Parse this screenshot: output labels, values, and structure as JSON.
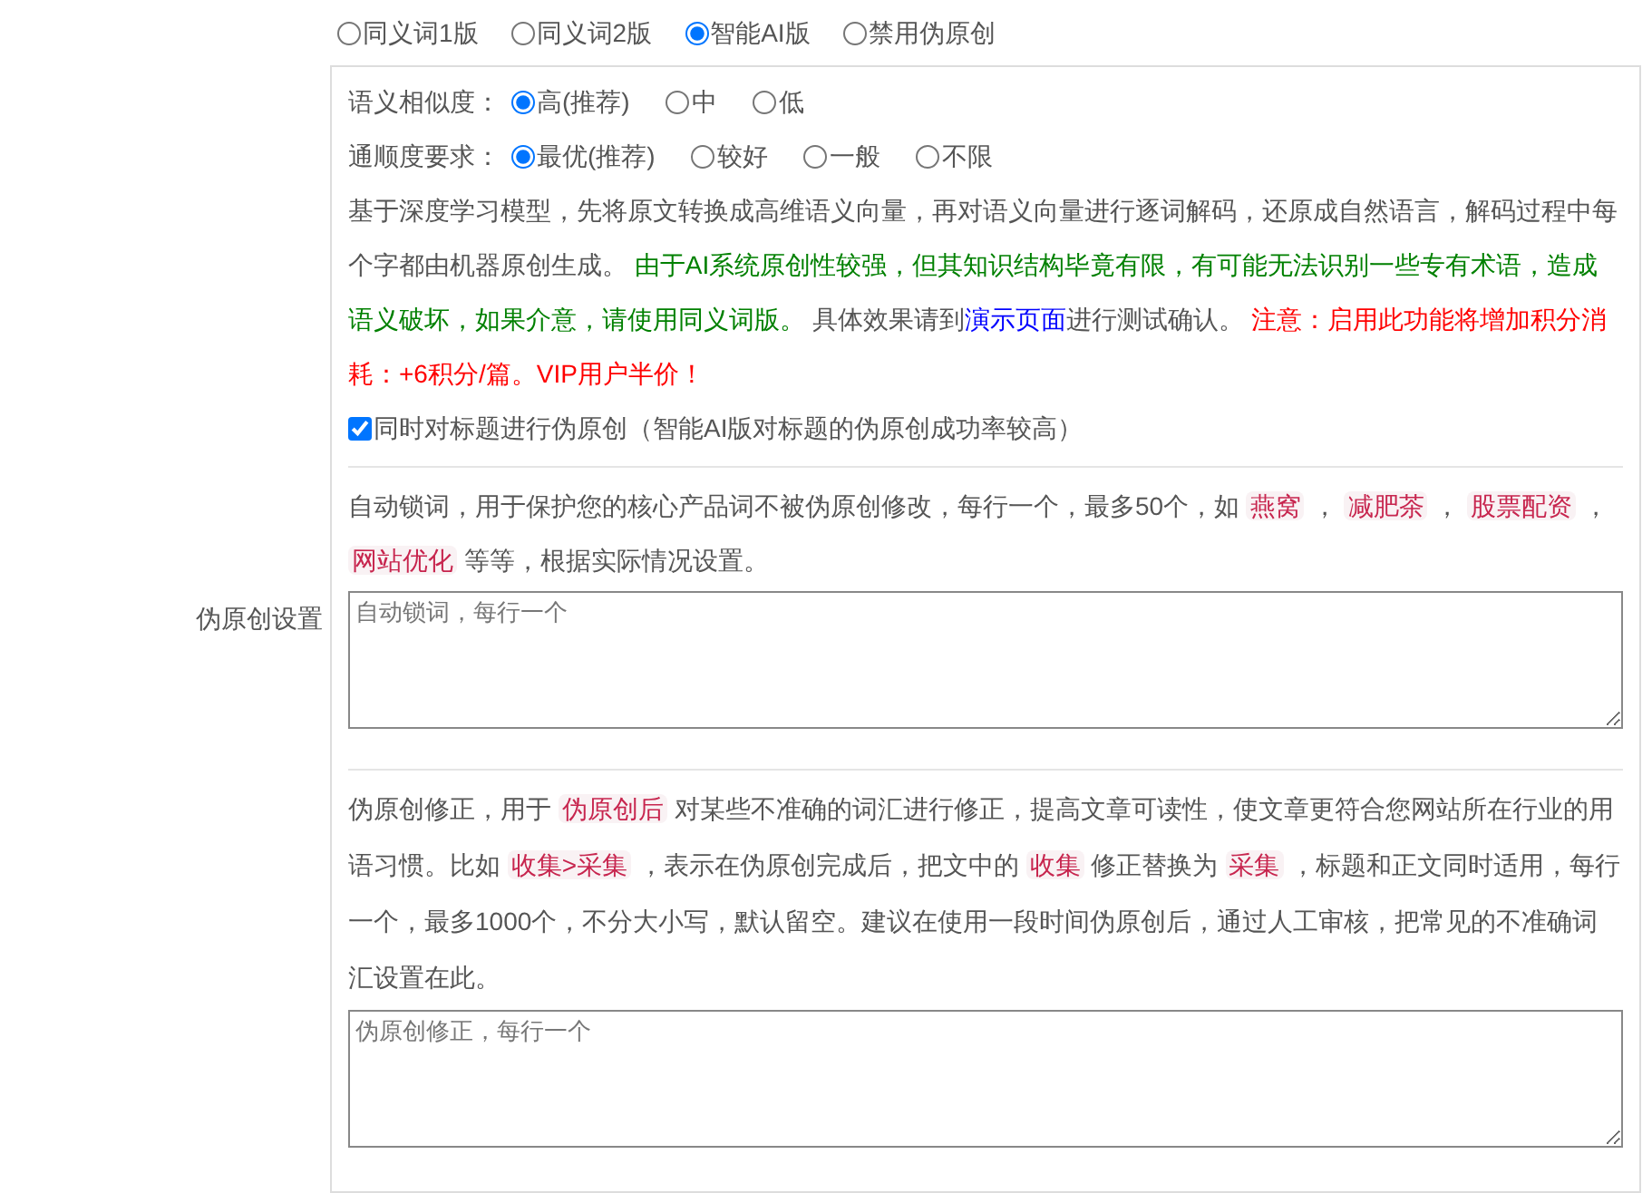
{
  "section_label": "伪原创设置",
  "modes": [
    {
      "label": "同义词1版",
      "selected": false
    },
    {
      "label": "同义词2版",
      "selected": false
    },
    {
      "label": "智能AI版",
      "selected": true
    },
    {
      "label": "禁用伪原创",
      "selected": false
    }
  ],
  "settings": [
    {
      "label": "语义相似度：",
      "options": [
        {
          "label": "高(推荐)",
          "selected": true
        },
        {
          "label": "中",
          "selected": false
        },
        {
          "label": "低",
          "selected": false
        }
      ]
    },
    {
      "label": "通顺度要求：",
      "options": [
        {
          "label": "最优(推荐)",
          "selected": true
        },
        {
          "label": "较好",
          "selected": false
        },
        {
          "label": "一般",
          "selected": false
        },
        {
          "label": "不限",
          "selected": false
        }
      ]
    }
  ],
  "description": [
    {
      "kind": "text",
      "text": "基于深度学习模型，先将原文转换成高维语义向量，再对语义向量进行逐词解码，还原成自然语言，解码过程中每个字都由机器原创生成。 "
    },
    {
      "kind": "notice",
      "text": "由于AI系统原创性较强，但其知识结构毕竟有限，有可能无法识别一些专有术语，造成语义破坏，如果介意，请使用同义词版。"
    },
    {
      "kind": "text",
      "text": " 具体效果请到"
    },
    {
      "kind": "link",
      "text": "演示页面"
    },
    {
      "kind": "text",
      "text": "进行测试确认。 "
    },
    {
      "kind": "warning",
      "text": "注意：启用此功能将增加积分消耗：+6积分/篇。VIP用户半价！"
    }
  ],
  "title_option": {
    "label": "同时对标题进行伪原创（智能AI版对标题的伪原创成功率较高）",
    "checked": true
  },
  "lock_words": {
    "description": [
      {
        "kind": "text",
        "text": "自动锁词，用于保护您的核心产品词不被伪原创修改，每行一个，最多50个，如 "
      },
      {
        "kind": "tag",
        "text": "燕窝"
      },
      {
        "kind": "text",
        "text": " ， "
      },
      {
        "kind": "tag",
        "text": "减肥茶"
      },
      {
        "kind": "text",
        "text": " ， "
      },
      {
        "kind": "tag",
        "text": "股票配资"
      },
      {
        "kind": "text",
        "text": " ， "
      },
      {
        "kind": "tag",
        "text": "网站优化"
      },
      {
        "kind": "text",
        "text": " 等等，根据实际情况设置。"
      }
    ],
    "placeholder": "自动锁词，每行一个"
  },
  "correction": {
    "description": [
      {
        "kind": "text",
        "text": "伪原创修正，用于 "
      },
      {
        "kind": "tag",
        "text": "伪原创后"
      },
      {
        "kind": "text",
        "text": " 对某些不准确的词汇进行修正，提高文章可读性，使文章更符合您网站所在行业的用语习惯。比如 "
      },
      {
        "kind": "tag",
        "text": "收集>采集"
      },
      {
        "kind": "text",
        "text": " ，表示在伪原创完成后，把文中的 "
      },
      {
        "kind": "tag",
        "text": "收集"
      },
      {
        "kind": "text",
        "text": " 修正替换为 "
      },
      {
        "kind": "tag",
        "text": "采集"
      },
      {
        "kind": "text",
        "text": " ，标题和正文同时适用，每行一个，最多1000个，不分大小写，默认留空。建议在使用一段时间伪原创后，通过人工审核，把常见的不准确词汇设置在此。"
      }
    ],
    "placeholder": "伪原创修正，每行一个"
  }
}
